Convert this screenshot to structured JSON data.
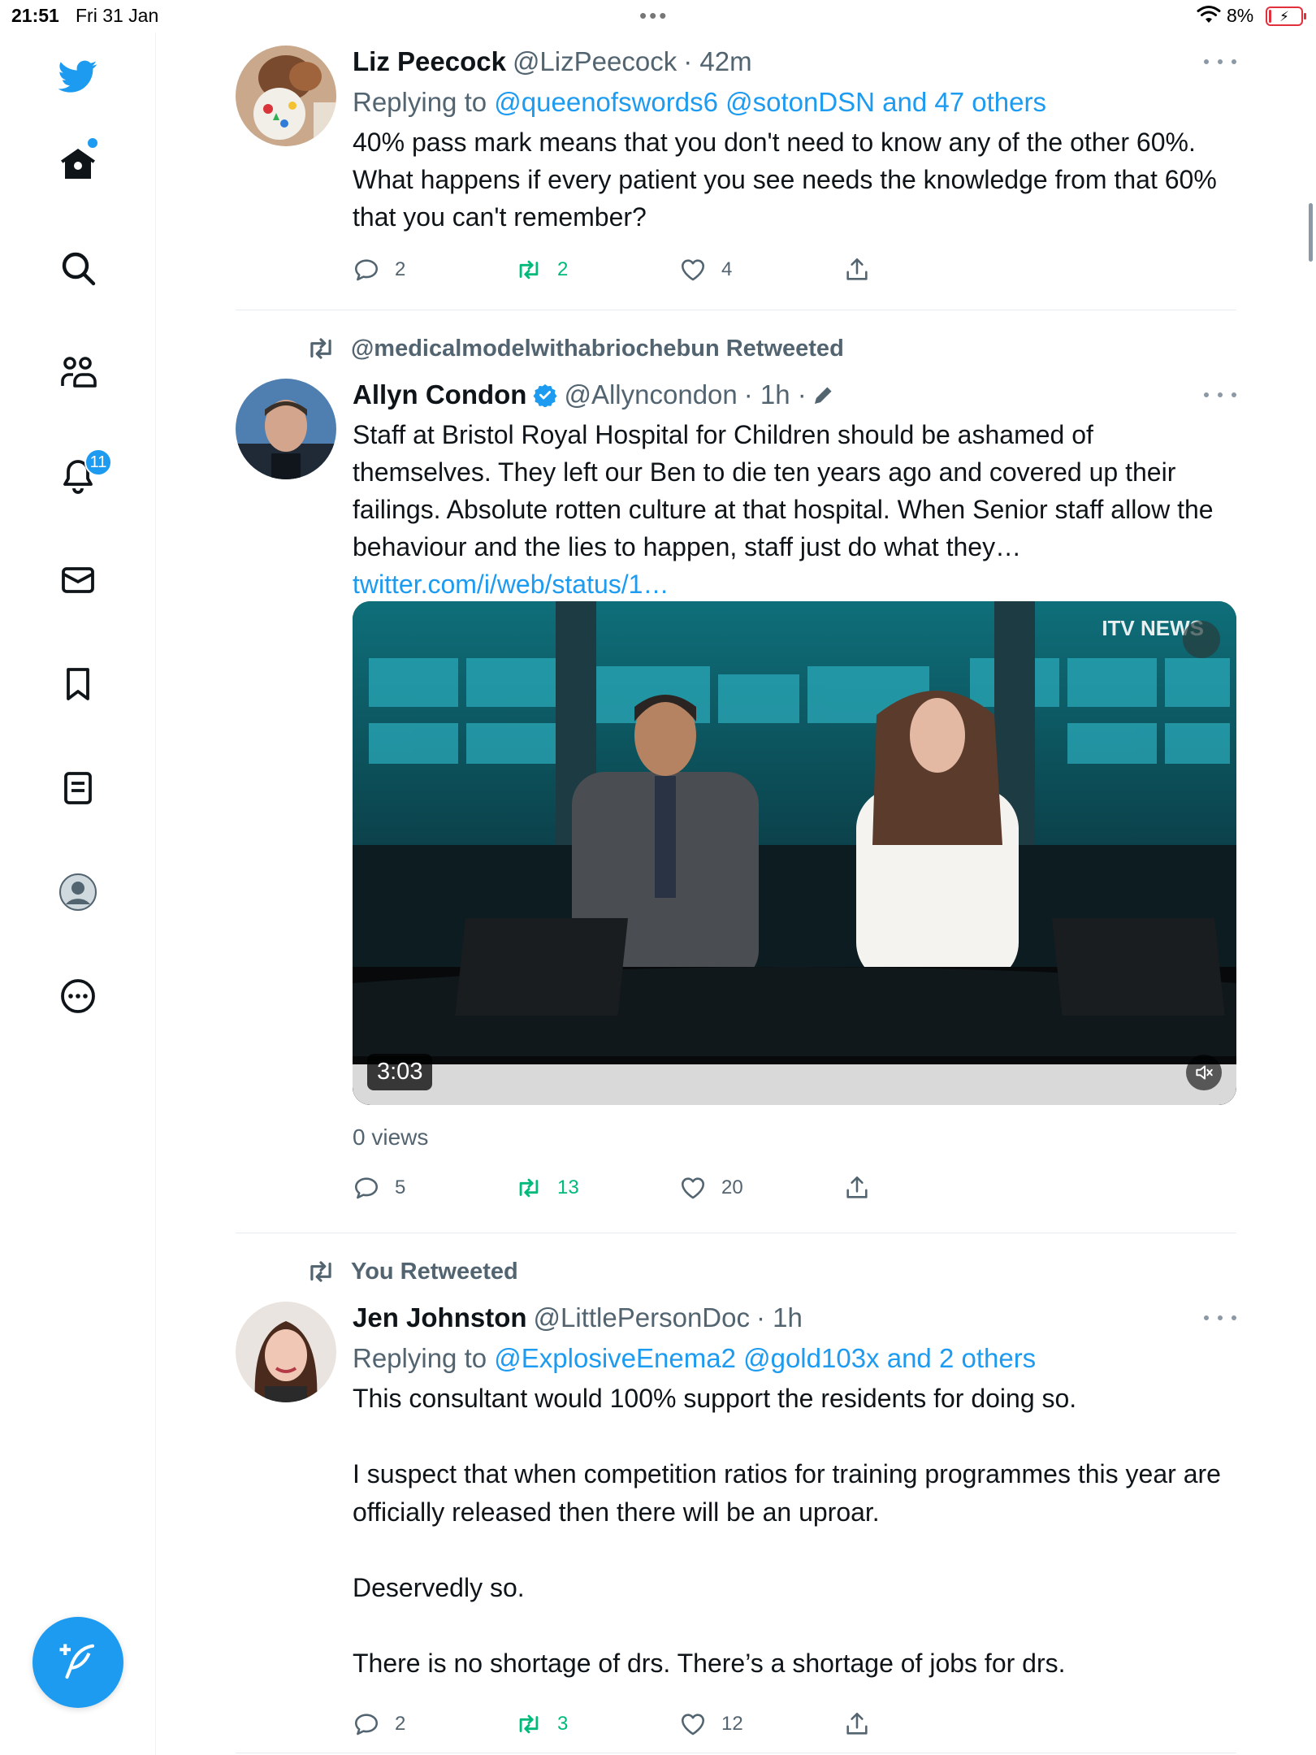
{
  "status_bar": {
    "time": "21:51",
    "date": "Fri 31 Jan",
    "battery_percent": "8%",
    "battery_level": 0.08
  },
  "sidebar": {
    "items": [
      {
        "name": "home",
        "icon": "home-icon"
      },
      {
        "name": "explore",
        "icon": "search-icon"
      },
      {
        "name": "communities",
        "icon": "communities-icon"
      },
      {
        "name": "notifications",
        "icon": "bell-icon",
        "badge": "11"
      },
      {
        "name": "messages",
        "icon": "mail-icon"
      },
      {
        "name": "bookmarks",
        "icon": "bookmark-icon"
      },
      {
        "name": "lists",
        "icon": "lists-icon"
      },
      {
        "name": "profile",
        "icon": "profile-icon"
      },
      {
        "name": "more",
        "icon": "more-circle-icon"
      }
    ],
    "compose_icon": "compose-tweet-icon"
  },
  "tweets": [
    {
      "name": "Liz Peecock",
      "handle": "@LizPeecock",
      "time": "· 42m",
      "replying_label": "Replying to",
      "replying_to": "@queenofswords6 @sotonDSN and 47 others",
      "text": "40% pass mark means that you don't need to know any of the other 60%.  What happens if every patient you see needs the knowledge from that 60% that you can't remember?",
      "replies": "2",
      "retweets": "2",
      "likes": "4",
      "retweeted_by_me": true
    },
    {
      "social_context": "@medicalmodelwithabriochebun Retweeted",
      "name": "Allyn Condon",
      "verified": true,
      "handle": "@Allyncondon",
      "time": "· 1h ·",
      "text": "Staff at Bristol Royal Hospital for Children should be ashamed of themselves. They left our Ben to die ten years ago and covered up their failings. Absolute rotten culture at that hospital. When Senior staff allow the behaviour and the lies to happen, staff just do what they…",
      "link": "twitter.com/i/web/status/1…",
      "media": {
        "logo": "ITV NEWS",
        "duration": "3:03"
      },
      "views": "0 views",
      "replies": "5",
      "retweets": "13",
      "likes": "20"
    },
    {
      "social_context": "You Retweeted",
      "name": "Jen Johnston",
      "handle": "@LittlePersonDoc",
      "time": "· 1h",
      "replying_label": "Replying to",
      "replying_to": "@ExplosiveEnema2 @gold103x and 2 others",
      "text": "This consultant would 100% support the residents for doing so.\n\nI suspect that when competition ratios for training programmes this year are officially released then there will be an uproar.\n\nDeservedly so.\n\nThere is no shortage of drs. There’s a shortage of jobs for drs.",
      "replies": "2",
      "retweets": "3",
      "likes": "12"
    }
  ],
  "colors": {
    "accent": "#1d9bf0",
    "retweet_green": "#00ba7c",
    "secondary_text": "#536471",
    "battery_low": "#e0313d"
  }
}
